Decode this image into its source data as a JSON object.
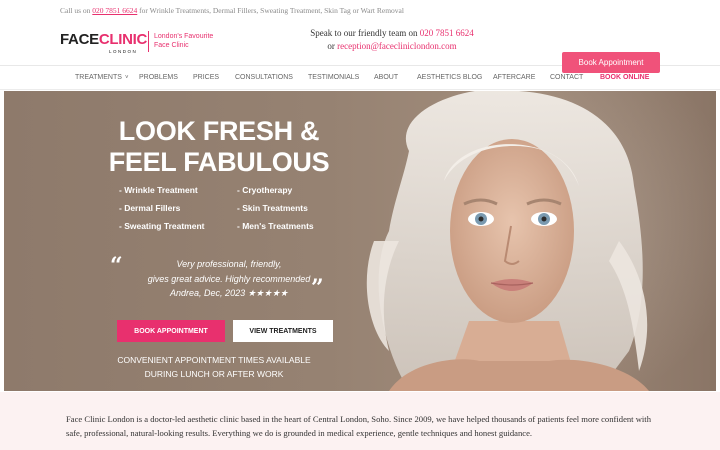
{
  "topbar": {
    "prefix": "Call us on ",
    "phone": "020 7851 6624",
    "suffix": " for Wrinkle Treatments, Dermal Fillers, Sweating Treatment, Skin Tag or Wart Removal"
  },
  "logo": {
    "face": "FACE",
    "clinic": "CLINIC",
    "london": "LONDON",
    "tagline_1": "London's Favourite",
    "tagline_2": "Face Clinic"
  },
  "contact": {
    "speak": "Speak to our friendly team on ",
    "phone": "020 7851 6624",
    "or": "or ",
    "email": "reception@facecliniclondon.com"
  },
  "header": {
    "book_label": "Book Appointment"
  },
  "nav": {
    "items": [
      "TREATMENTS",
      "PROBLEMS",
      "PRICES",
      "CONSULTATIONS",
      "TESTIMONIALS",
      "ABOUT",
      "AESTHETICS BLOG",
      "AFTERCARE",
      "CONTACT",
      "BOOK ONLINE"
    ]
  },
  "hero": {
    "headline_1": "LOOK FRESH &",
    "headline_2": "FEEL FABULOUS",
    "treatments_left": [
      "- Wrinkle Treatment",
      "- Dermal Fillers",
      "- Sweating Treatment"
    ],
    "treatments_right": [
      "- Cryotherapy",
      "- Skin Treatments",
      "- Men's Treatments"
    ],
    "testimonial_1": "Very professional, friendly,",
    "testimonial_2": "gives great advice. Highly recommended",
    "testimonial_author": "Andrea, Dec, 2023",
    "stars": "★★★★★",
    "rating": 5,
    "book_label": "BOOK APPOINTMENT",
    "view_label": "VIEW TREATMENTS",
    "convenient_1": "CONVENIENT APPOINTMENT TIMES AVAILABLE",
    "convenient_2": "DURING LUNCH OR AFTER WORK"
  },
  "intro": {
    "text": "Face Clinic London is a doctor-led aesthetic clinic based in the heart of Central London, Soho. Since 2009, we have helped thousands of patients feel more confident with safe, professional, natural-looking results. Everything we do is grounded in medical experience, gentle techniques and honest guidance."
  },
  "colors": {
    "accent": "#e8306e",
    "header_button": "#f0527a",
    "hero_bg": "#968272",
    "intro_bg": "#fcf2f2"
  }
}
